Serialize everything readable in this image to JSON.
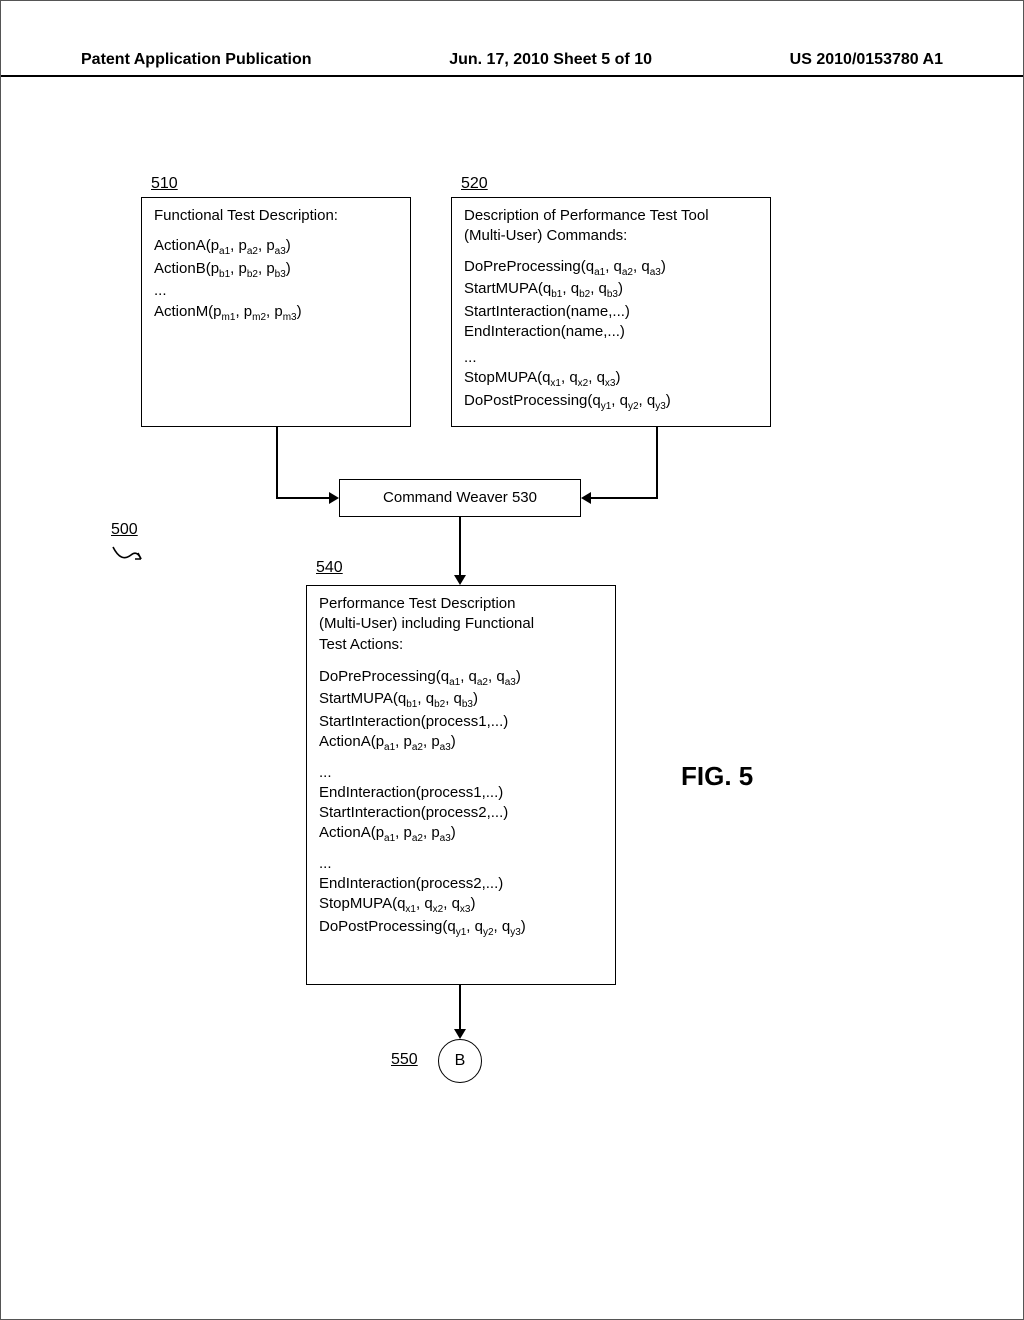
{
  "header": {
    "left": "Patent Application Publication",
    "center": "Jun. 17, 2010 Sheet 5 of 10",
    "right": "US 2010/0153780 A1"
  },
  "refs": {
    "r500": "500",
    "r510": "510",
    "r520": "520",
    "r540": "540",
    "r550": "550"
  },
  "box510": {
    "title": "Functional Test Description:",
    "line1a": "ActionA(p",
    "line1b": ", p",
    "line1c": ", p",
    "line1d": ")",
    "s1a": "a1",
    "s1b": "a2",
    "s1c": "a3",
    "line2a": "ActionB(p",
    "line2b": ", p",
    "line2c": ", p",
    "line2d": ")",
    "s2a": "b1",
    "s2b": "b2",
    "s2c": "b3",
    "ell": "...",
    "line3a": "ActionM(p",
    "line3b": ", p",
    "line3c": ", p",
    "line3d": ")",
    "s3a": "m1",
    "s3b": "m2",
    "s3c": "m3"
  },
  "box520": {
    "title1": "Description of Performance Test Tool",
    "title2": "(Multi-User) Commands:",
    "l1a": "DoPreProcessing(q",
    "l1b": ", q",
    "l1c": ", q",
    "l1d": ")",
    "s1a": "a1",
    "s1b": "a2",
    "s1c": "a3",
    "l2a": "StartMUPA(q",
    "l2b": ", q",
    "l2c": ", q",
    "l2d": ")",
    "s2a": "b1",
    "s2b": "b2",
    "s2c": "b3",
    "l3": "StartInteraction(name,...)",
    "l4": "EndInteraction(name,...)",
    "ell": "...",
    "l5a": "StopMUPA(q",
    "l5b": ", q",
    "l5c": ", q",
    "l5d": ")",
    "s5a": "x1",
    "s5b": "x2",
    "s5c": "x3",
    "l6a": "DoPostProcessing(q",
    "l6b": ", q",
    "l6c": ", q",
    "l6d": ")",
    "s6a": "y1",
    "s6b": "y2",
    "s6c": "y3"
  },
  "box530": {
    "text": "Command Weaver 530"
  },
  "box540": {
    "title1": "Performance Test Description",
    "title2": "(Multi-User) including Functional",
    "title3": "Test Actions:",
    "l1a": "DoPreProcessing(q",
    "l1b": ", q",
    "l1c": ", q",
    "l1d": ")",
    "s1a": "a1",
    "s1b": "a2",
    "s1c": "a3",
    "l2a": "StartMUPA(q",
    "l2b": ", q",
    "l2c": ", q",
    "l2d": ")",
    "s2a": "b1",
    "s2b": "b2",
    "s2c": "b3",
    "l3": "StartInteraction(process1,...)",
    "l4a": "ActionA(p",
    "l4b": ", p",
    "l4c": ", p",
    "l4d": ")",
    "s4a": "a1",
    "s4b": "a2",
    "s4c": "a3",
    "ell1": "...",
    "l5": "EndInteraction(process1,...)",
    "l6": "StartInteraction(process2,...)",
    "l7a": "ActionA(p",
    "l7b": ", p",
    "l7c": ", p",
    "l7d": ")",
    "s7a": "a1",
    "s7b": "a2",
    "s7c": "a3",
    "ell2": "...",
    "l8": "EndInteraction(process2,...)",
    "l9a": "StopMUPA(q",
    "l9b": ", q",
    "l9c": ", q",
    "l9d": ")",
    "s9a": "x1",
    "s9b": "x2",
    "s9c": "x3",
    "l10a": "DoPostProcessing(q",
    "l10b": ", q",
    "l10c": ", q",
    "l10d": ")",
    "s10a": "y1",
    "s10b": "y2",
    "s10c": "y3"
  },
  "circleB": "B",
  "figTitle": "FIG. 5"
}
